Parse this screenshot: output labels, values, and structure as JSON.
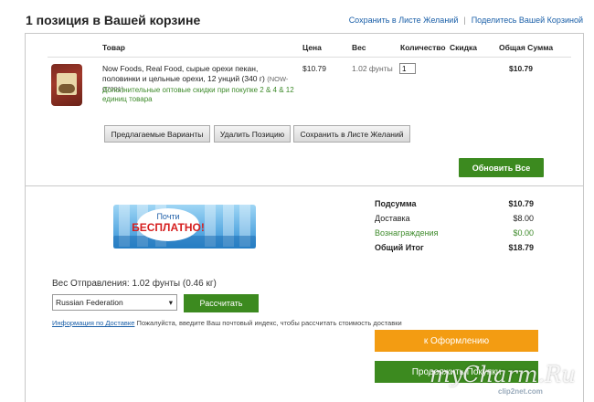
{
  "header": {
    "title": "1 позиция в Вашей корзине",
    "wishlist_link": "Сохранить в Листе Желаний",
    "separator": "|",
    "share_link": "Поделитесь Вашей Корзиной"
  },
  "table": {
    "columns": [
      "Товар",
      "Цена",
      "Вес",
      "Количество",
      "Скидка",
      "Общая Сумма"
    ]
  },
  "item": {
    "image_icon": "product-bag-icon",
    "name": "Now Foods, Real Food, сырые орехи пекан, половинки и цельные орехи, 12 унций (340 г)",
    "sku": "(NOW-07001)",
    "discount_note": "Дополнительные оптовые скидки при покупке 2 & 4 & 12 единиц товара",
    "price": "$10.79",
    "weight": "1.02 фунты",
    "quantity": "1",
    "total": "$10.79"
  },
  "item_actions": {
    "suggested": "Предлагаемые Варианты",
    "remove": "Удалить Позицию",
    "save": "Сохранить в Листе Желаний"
  },
  "update_button": "Обновить Все",
  "promo": {
    "line1": "Почти",
    "line2": "БЕСПЛАТНО!"
  },
  "summary": [
    {
      "label": "Подсумма",
      "value": "$10.79",
      "style": "bold"
    },
    {
      "label": "Доставка",
      "value": "$8.00",
      "style": "normal"
    },
    {
      "label": "Вознаграждения",
      "value": "$0.00",
      "style": "green"
    },
    {
      "label": "Общий Итог",
      "value": "$18.79",
      "style": "bold"
    }
  ],
  "shipping": {
    "weight_label": "Вес Отправления: 1.02 фунты (0.46 кг)",
    "country": "Russian Federation",
    "calculate_button": "Рассчитать",
    "info_link": "Информация по Доставке",
    "info_text": "Пожалуйста, введите Ваш почтовый индекс, чтобы рассчитать стоимость доставки"
  },
  "checkout_button": "к Оформлению",
  "continue_button": "Продолжить Покупки",
  "watermark": {
    "text": "myCharm.Ru",
    "sub": "clip2net.com"
  },
  "colors": {
    "green": "#3c8a1f",
    "orange": "#f39c12",
    "link": "#1a5fa8"
  }
}
